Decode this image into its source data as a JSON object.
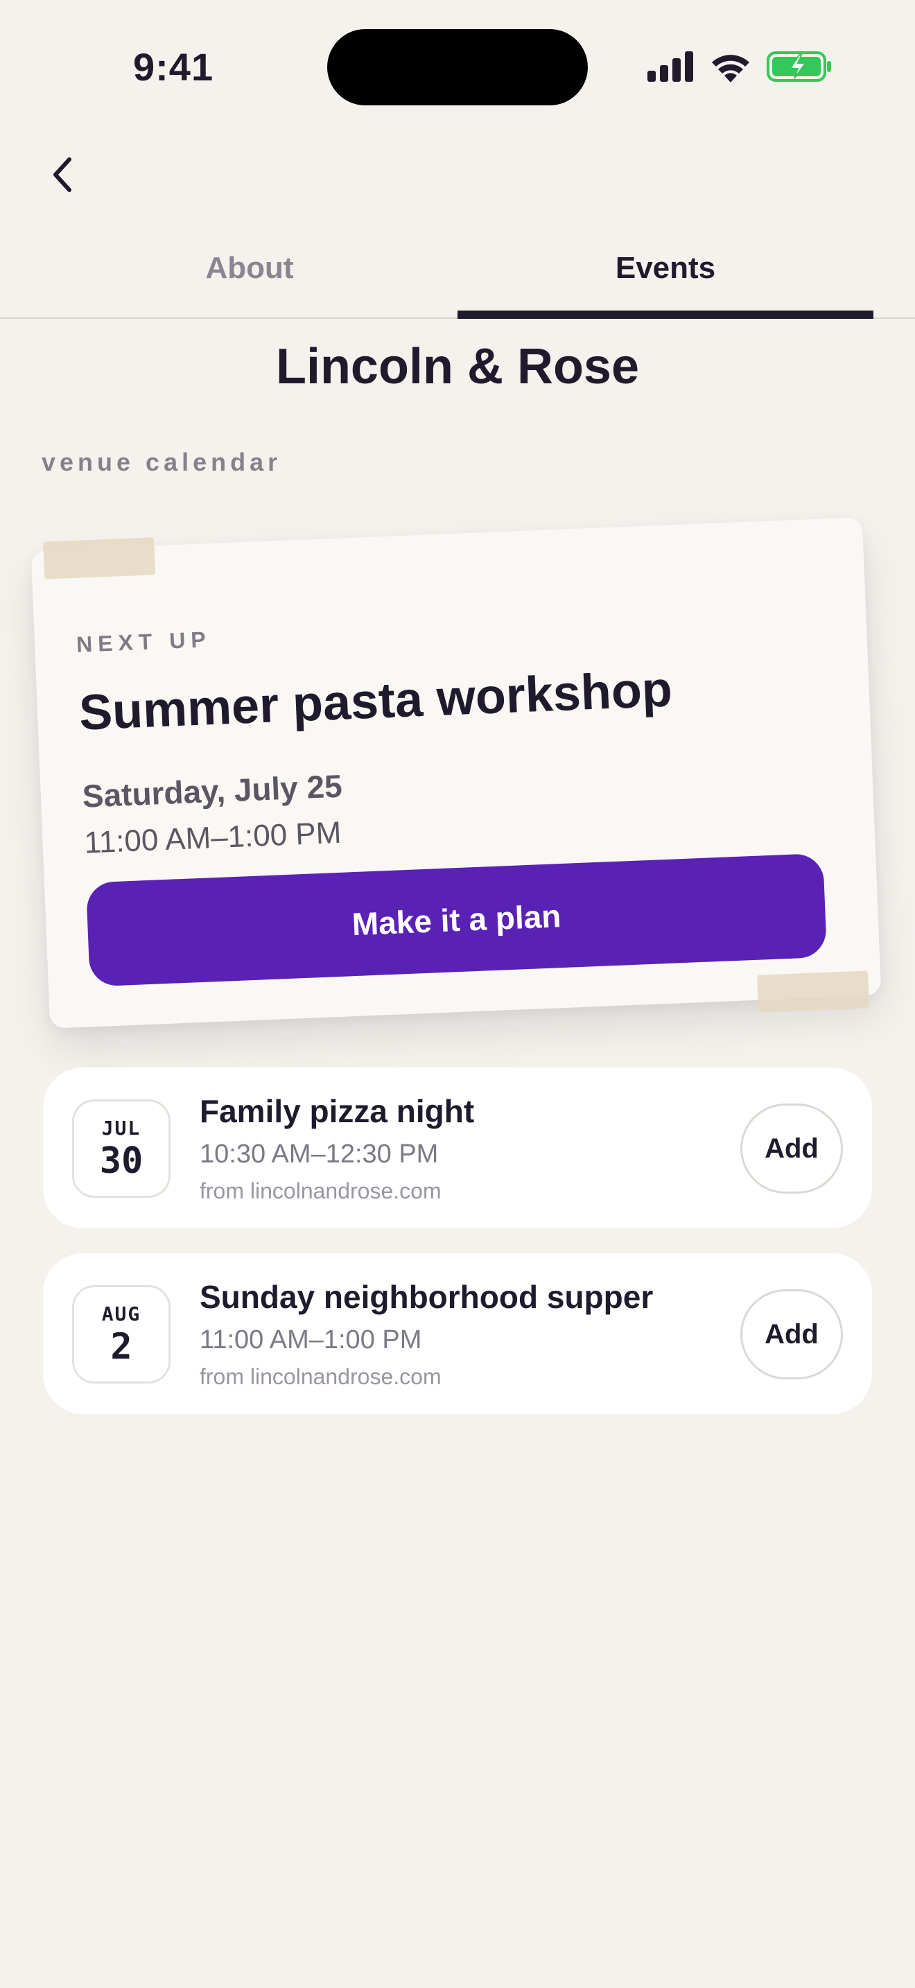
{
  "status_bar": {
    "time": "9:41",
    "icons": [
      "cellular-signal-icon",
      "wifi-icon",
      "battery-charging-icon"
    ],
    "battery_color": "#34c759"
  },
  "nav": {
    "back_icon": "chevron-left-icon"
  },
  "tabs": [
    {
      "label": "About",
      "active": false
    },
    {
      "label": "Events",
      "active": true
    }
  ],
  "venue": {
    "name": "Lincoln & Rose",
    "subtitle": "venue calendar"
  },
  "featured": {
    "eyebrow": "NEXT UP",
    "title": "Summer pasta workshop",
    "date": "Saturday, July 25",
    "time": "11:00 AM–1:00 PM",
    "cta_label": "Make it a plan",
    "accent_color": "#5a21b5"
  },
  "events": [
    {
      "month": "JUL",
      "day": "30",
      "name": "Family pizza night",
      "time": "10:30 AM–12:30 PM",
      "source": "from lincolnandrose.com",
      "action_label": "Add"
    },
    {
      "month": "AUG",
      "day": "2",
      "name": "Sunday neighborhood supper",
      "time": "11:00 AM–1:00 PM",
      "source": "from lincolnandrose.com",
      "action_label": "Add"
    }
  ]
}
